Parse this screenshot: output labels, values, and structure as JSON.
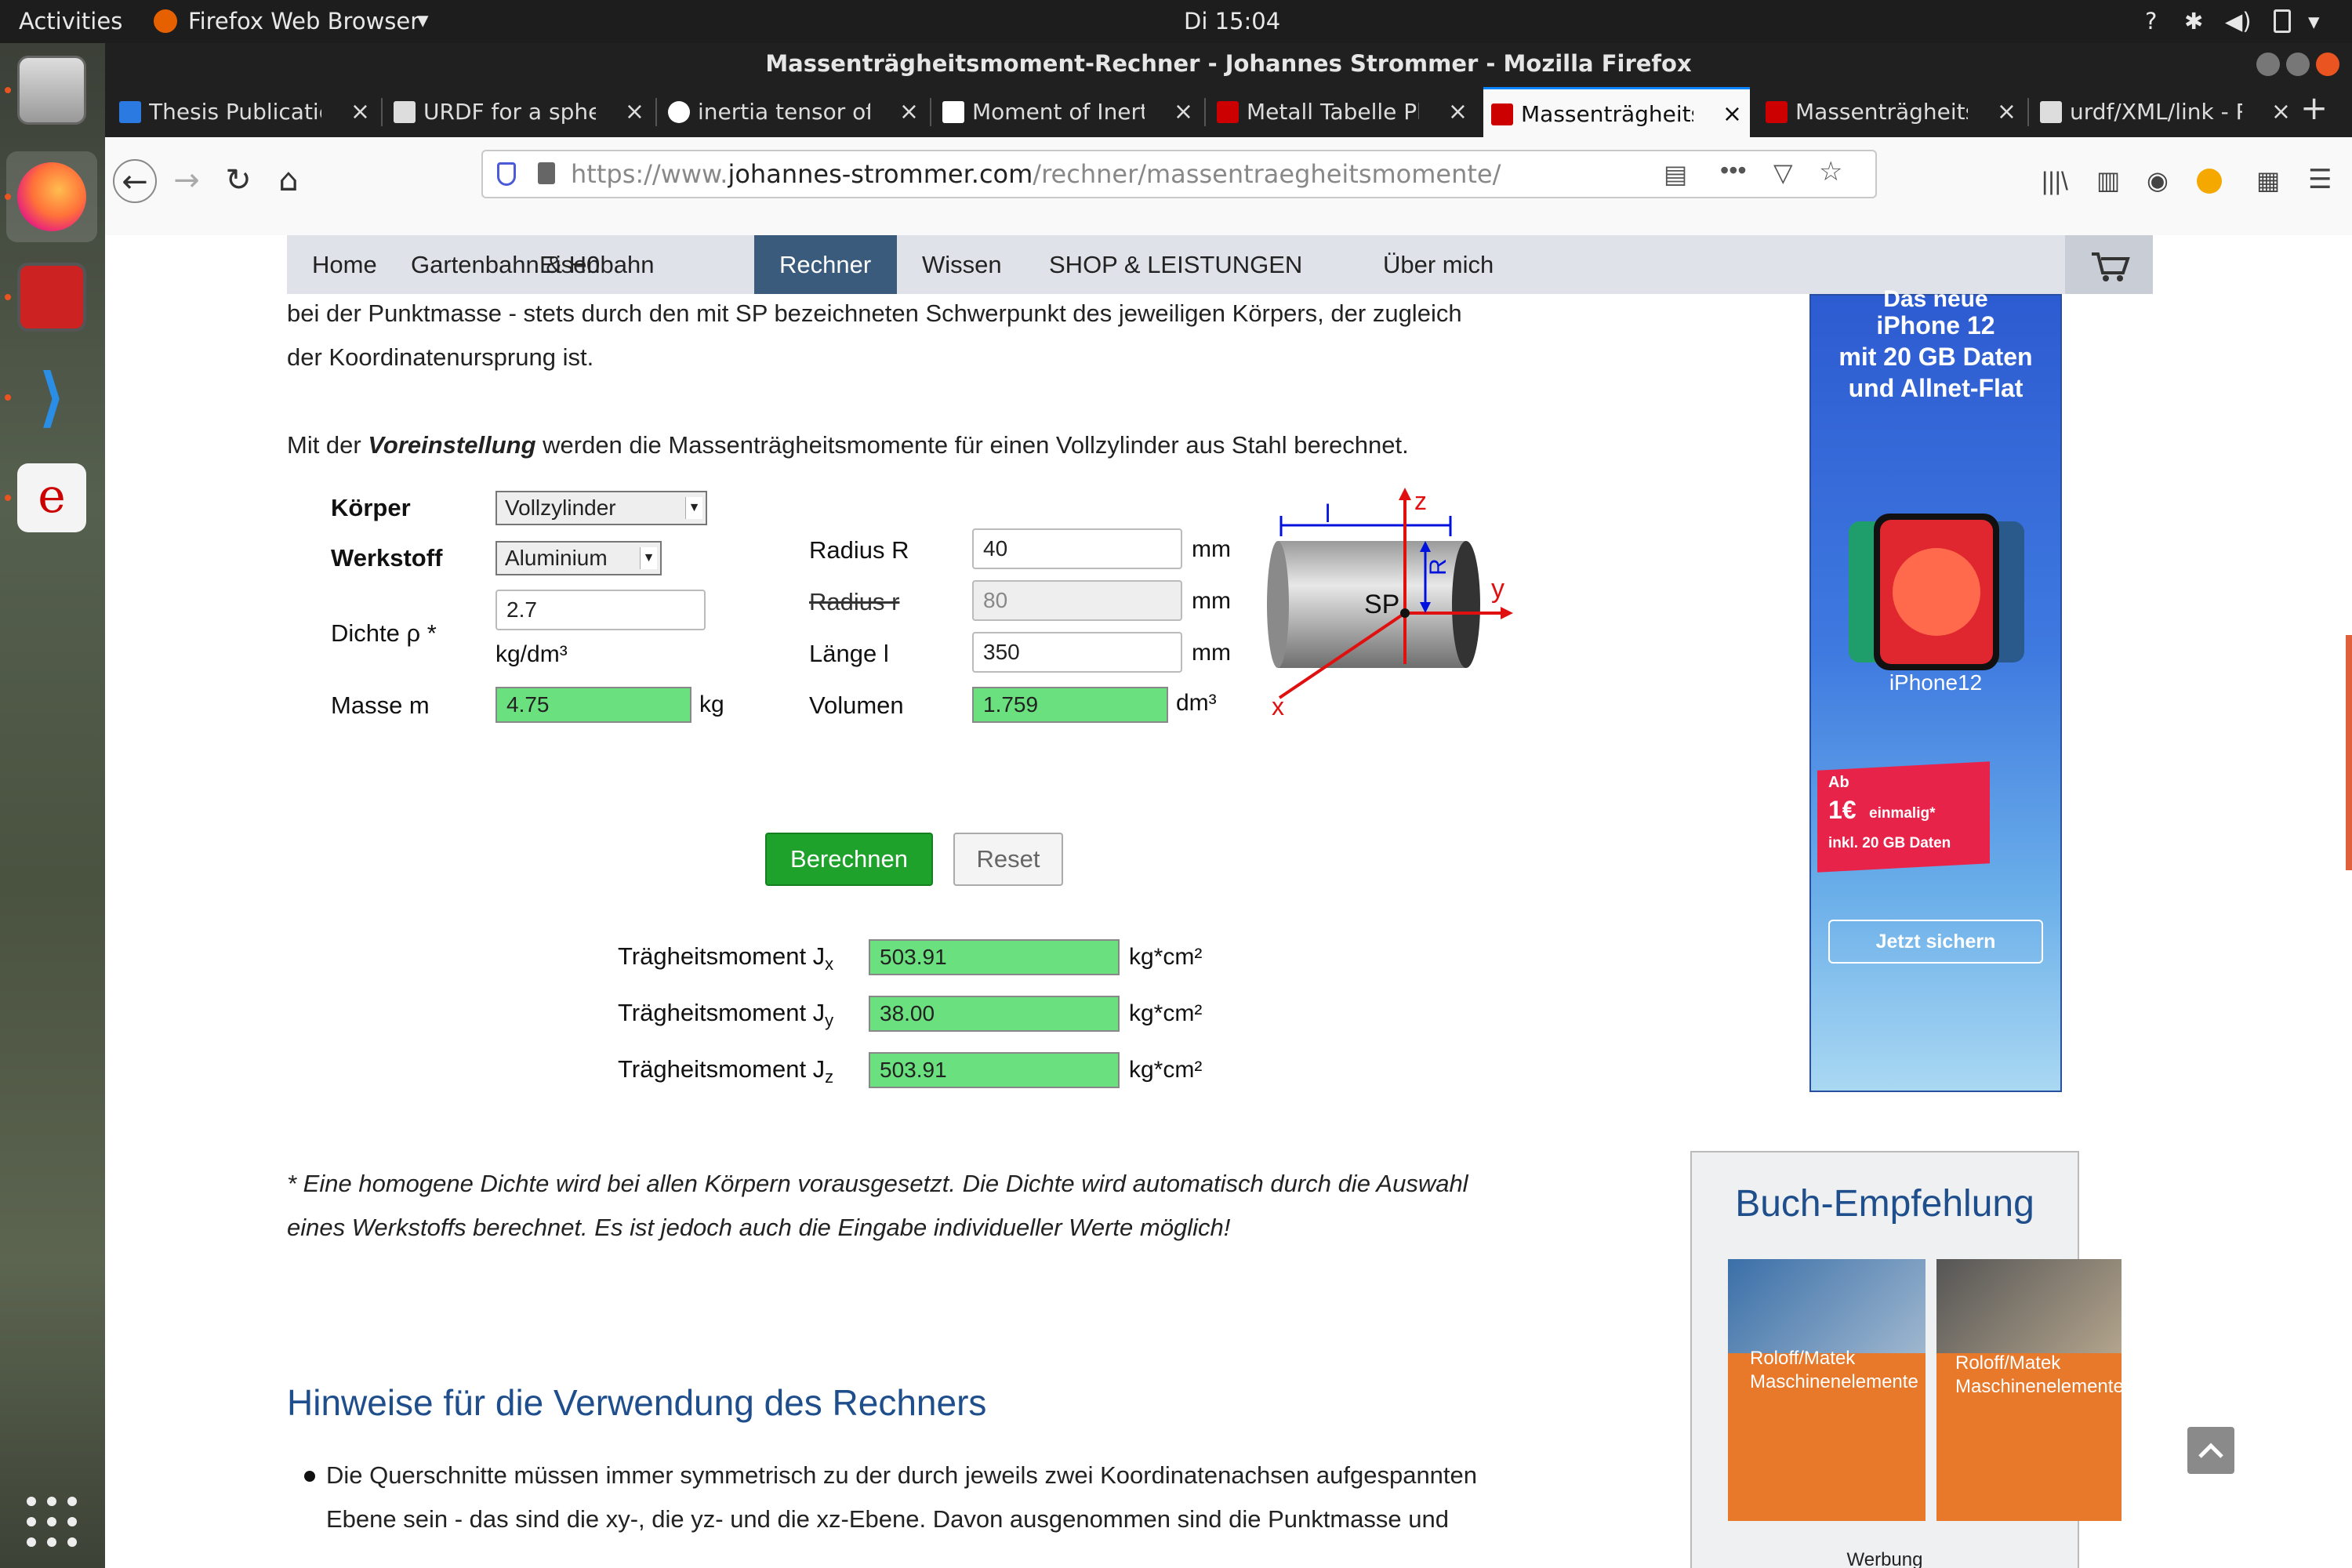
{
  "topbar": {
    "activities": "Activities",
    "app_menu": "Firefox Web Browser",
    "clock": "Di 15:04"
  },
  "window": {
    "title": "Massenträgheitsmoment-Rechner - Johannes Strommer - Mozilla Firefox"
  },
  "tabs": [
    {
      "label": "Thesis Publication"
    },
    {
      "label": "URDF for a sphere"
    },
    {
      "label": "inertia tensor of"
    },
    {
      "label": "Moment of Inertia--S"
    },
    {
      "label": "Metall Tabelle Ph"
    },
    {
      "label": "Massenträgheitsm"
    },
    {
      "label": "Massenträgheitsm"
    },
    {
      "label": "urdf/XML/link - R"
    }
  ],
  "url": {
    "prefix": "https://www.",
    "domain": "johannes-strommer.com",
    "path": "/rechner/massentraegheitsmomente/"
  },
  "menu": [
    "Home",
    "Gartenbahn & H0",
    "Eisenbahn",
    "Rechner",
    "Wissen",
    "SHOP & LEISTUNGEN",
    "Über mich"
  ],
  "content": {
    "intro_line1": "bei der Punktmasse - stets durch den mit SP bezeichneten Schwerpunkt des jeweiligen Körpers, der zugleich",
    "intro_line2": "der Koordinatenursprung ist.",
    "preset_pre": "Mit der ",
    "preset_em": "Voreinstellung",
    "preset_post": " werden die Massenträgheitsmomente für einen Vollzylinder aus Stahl berechnet.",
    "note_line1": "* Eine homogene Dichte wird bei allen Körpern vorausgesetzt. Die Dichte wird automatisch durch die Auswahl",
    "note_line2": "eines Werkstoffs berechnet. Es ist jedoch auch die Eingabe individueller Werte möglich!",
    "heading": "Hinweise für die Verwendung des Rechners",
    "bullet_line1": "Die Querschnitte müssen immer symmetrisch zu der durch jeweils zwei Koordinatenachsen aufgespannten",
    "bullet_line2": "Ebene sein - das sind die xy-, die yz- und die xz-Ebene. Davon ausgenommen sind die Punktmasse und"
  },
  "form": {
    "koerper_label": "Körper",
    "koerper_value": "Vollzylinder",
    "werkstoff_label": "Werkstoff",
    "werkstoff_value": "Aluminium",
    "dichte_label": "Dichte ρ *",
    "dichte_value": "2.7",
    "dichte_unit": "kg/dm³",
    "masse_label": "Masse m",
    "masse_value": "4.75",
    "masse_unit": "kg",
    "radius_R_label": "Radius R",
    "radius_R_value": "40",
    "radius_r_label": "Radius r",
    "radius_r_value": "80",
    "laenge_label": "Länge l",
    "laenge_value": "350",
    "volumen_label": "Volumen",
    "volumen_value": "1.759",
    "unit_mm": "mm",
    "volumen_unit": "dm³",
    "berechnen": "Berechnen",
    "reset": "Reset",
    "jx_label": "Trägheitsmoment J",
    "jx_sub": "x",
    "jx_value": "503.91",
    "jy_sub": "y",
    "jy_value": "38.00",
    "jz_sub": "z",
    "jz_value": "503.91",
    "j_unit": "kg*cm²"
  },
  "diagram": {
    "l": "l",
    "z": "z",
    "y": "y",
    "x": "x",
    "R": "R",
    "sp": "SP"
  },
  "ad": {
    "line0": "Das neue",
    "line1": "iPhone 12",
    "line2": "mit 20 GB Daten",
    "line3": "und Allnet-Flat",
    "brand": "iPhone12",
    "price_ab": "Ab",
    "price": "1€",
    "price_note": "einmalig*",
    "price_sub": "inkl. 20 GB Daten",
    "cta": "Jetzt sichern"
  },
  "book": {
    "title": "Buch-Empfehlung",
    "book1_title": "Roloff/Matek Maschinenelemente",
    "book2_title": "Roloff/Matek Maschinenelemente",
    "werbung": "Werbung"
  },
  "colors": {
    "menu_active": "#3a5b7c",
    "green_field": "#6be07f",
    "button_green": "#1fa22c",
    "heading_blue": "#1f4e8c"
  }
}
